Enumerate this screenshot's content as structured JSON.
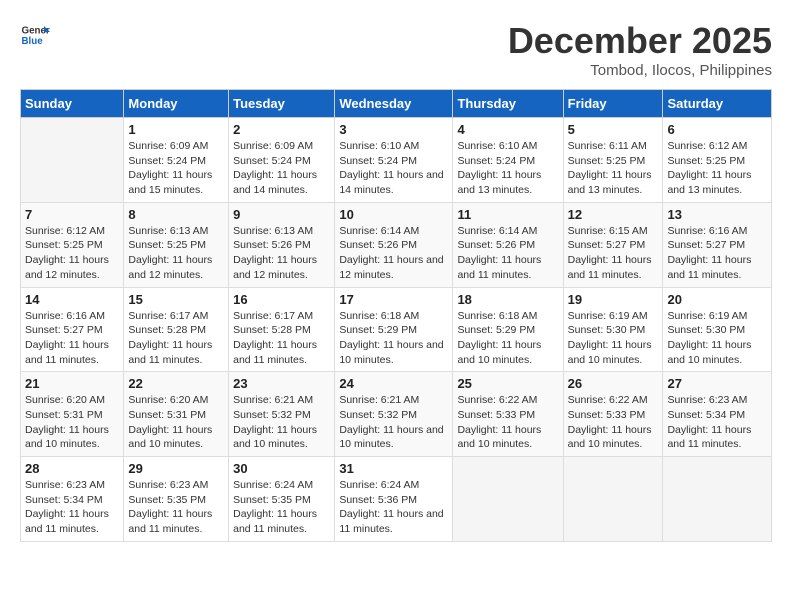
{
  "header": {
    "logo_line1": "General",
    "logo_line2": "Blue",
    "month": "December 2025",
    "location": "Tombod, Ilocos, Philippines"
  },
  "days_of_week": [
    "Sunday",
    "Monday",
    "Tuesday",
    "Wednesday",
    "Thursday",
    "Friday",
    "Saturday"
  ],
  "weeks": [
    [
      {
        "day": "",
        "sunrise": "",
        "sunset": "",
        "daylight": ""
      },
      {
        "day": "1",
        "sunrise": "Sunrise: 6:09 AM",
        "sunset": "Sunset: 5:24 PM",
        "daylight": "Daylight: 11 hours and 15 minutes."
      },
      {
        "day": "2",
        "sunrise": "Sunrise: 6:09 AM",
        "sunset": "Sunset: 5:24 PM",
        "daylight": "Daylight: 11 hours and 14 minutes."
      },
      {
        "day": "3",
        "sunrise": "Sunrise: 6:10 AM",
        "sunset": "Sunset: 5:24 PM",
        "daylight": "Daylight: 11 hours and 14 minutes."
      },
      {
        "day": "4",
        "sunrise": "Sunrise: 6:10 AM",
        "sunset": "Sunset: 5:24 PM",
        "daylight": "Daylight: 11 hours and 13 minutes."
      },
      {
        "day": "5",
        "sunrise": "Sunrise: 6:11 AM",
        "sunset": "Sunset: 5:25 PM",
        "daylight": "Daylight: 11 hours and 13 minutes."
      },
      {
        "day": "6",
        "sunrise": "Sunrise: 6:12 AM",
        "sunset": "Sunset: 5:25 PM",
        "daylight": "Daylight: 11 hours and 13 minutes."
      }
    ],
    [
      {
        "day": "7",
        "sunrise": "Sunrise: 6:12 AM",
        "sunset": "Sunset: 5:25 PM",
        "daylight": "Daylight: 11 hours and 12 minutes."
      },
      {
        "day": "8",
        "sunrise": "Sunrise: 6:13 AM",
        "sunset": "Sunset: 5:25 PM",
        "daylight": "Daylight: 11 hours and 12 minutes."
      },
      {
        "day": "9",
        "sunrise": "Sunrise: 6:13 AM",
        "sunset": "Sunset: 5:26 PM",
        "daylight": "Daylight: 11 hours and 12 minutes."
      },
      {
        "day": "10",
        "sunrise": "Sunrise: 6:14 AM",
        "sunset": "Sunset: 5:26 PM",
        "daylight": "Daylight: 11 hours and 12 minutes."
      },
      {
        "day": "11",
        "sunrise": "Sunrise: 6:14 AM",
        "sunset": "Sunset: 5:26 PM",
        "daylight": "Daylight: 11 hours and 11 minutes."
      },
      {
        "day": "12",
        "sunrise": "Sunrise: 6:15 AM",
        "sunset": "Sunset: 5:27 PM",
        "daylight": "Daylight: 11 hours and 11 minutes."
      },
      {
        "day": "13",
        "sunrise": "Sunrise: 6:16 AM",
        "sunset": "Sunset: 5:27 PM",
        "daylight": "Daylight: 11 hours and 11 minutes."
      }
    ],
    [
      {
        "day": "14",
        "sunrise": "Sunrise: 6:16 AM",
        "sunset": "Sunset: 5:27 PM",
        "daylight": "Daylight: 11 hours and 11 minutes."
      },
      {
        "day": "15",
        "sunrise": "Sunrise: 6:17 AM",
        "sunset": "Sunset: 5:28 PM",
        "daylight": "Daylight: 11 hours and 11 minutes."
      },
      {
        "day": "16",
        "sunrise": "Sunrise: 6:17 AM",
        "sunset": "Sunset: 5:28 PM",
        "daylight": "Daylight: 11 hours and 11 minutes."
      },
      {
        "day": "17",
        "sunrise": "Sunrise: 6:18 AM",
        "sunset": "Sunset: 5:29 PM",
        "daylight": "Daylight: 11 hours and 10 minutes."
      },
      {
        "day": "18",
        "sunrise": "Sunrise: 6:18 AM",
        "sunset": "Sunset: 5:29 PM",
        "daylight": "Daylight: 11 hours and 10 minutes."
      },
      {
        "day": "19",
        "sunrise": "Sunrise: 6:19 AM",
        "sunset": "Sunset: 5:30 PM",
        "daylight": "Daylight: 11 hours and 10 minutes."
      },
      {
        "day": "20",
        "sunrise": "Sunrise: 6:19 AM",
        "sunset": "Sunset: 5:30 PM",
        "daylight": "Daylight: 11 hours and 10 minutes."
      }
    ],
    [
      {
        "day": "21",
        "sunrise": "Sunrise: 6:20 AM",
        "sunset": "Sunset: 5:31 PM",
        "daylight": "Daylight: 11 hours and 10 minutes."
      },
      {
        "day": "22",
        "sunrise": "Sunrise: 6:20 AM",
        "sunset": "Sunset: 5:31 PM",
        "daylight": "Daylight: 11 hours and 10 minutes."
      },
      {
        "day": "23",
        "sunrise": "Sunrise: 6:21 AM",
        "sunset": "Sunset: 5:32 PM",
        "daylight": "Daylight: 11 hours and 10 minutes."
      },
      {
        "day": "24",
        "sunrise": "Sunrise: 6:21 AM",
        "sunset": "Sunset: 5:32 PM",
        "daylight": "Daylight: 11 hours and 10 minutes."
      },
      {
        "day": "25",
        "sunrise": "Sunrise: 6:22 AM",
        "sunset": "Sunset: 5:33 PM",
        "daylight": "Daylight: 11 hours and 10 minutes."
      },
      {
        "day": "26",
        "sunrise": "Sunrise: 6:22 AM",
        "sunset": "Sunset: 5:33 PM",
        "daylight": "Daylight: 11 hours and 10 minutes."
      },
      {
        "day": "27",
        "sunrise": "Sunrise: 6:23 AM",
        "sunset": "Sunset: 5:34 PM",
        "daylight": "Daylight: 11 hours and 11 minutes."
      }
    ],
    [
      {
        "day": "28",
        "sunrise": "Sunrise: 6:23 AM",
        "sunset": "Sunset: 5:34 PM",
        "daylight": "Daylight: 11 hours and 11 minutes."
      },
      {
        "day": "29",
        "sunrise": "Sunrise: 6:23 AM",
        "sunset": "Sunset: 5:35 PM",
        "daylight": "Daylight: 11 hours and 11 minutes."
      },
      {
        "day": "30",
        "sunrise": "Sunrise: 6:24 AM",
        "sunset": "Sunset: 5:35 PM",
        "daylight": "Daylight: 11 hours and 11 minutes."
      },
      {
        "day": "31",
        "sunrise": "Sunrise: 6:24 AM",
        "sunset": "Sunset: 5:36 PM",
        "daylight": "Daylight: 11 hours and 11 minutes."
      },
      {
        "day": "",
        "sunrise": "",
        "sunset": "",
        "daylight": ""
      },
      {
        "day": "",
        "sunrise": "",
        "sunset": "",
        "daylight": ""
      },
      {
        "day": "",
        "sunrise": "",
        "sunset": "",
        "daylight": ""
      }
    ]
  ]
}
